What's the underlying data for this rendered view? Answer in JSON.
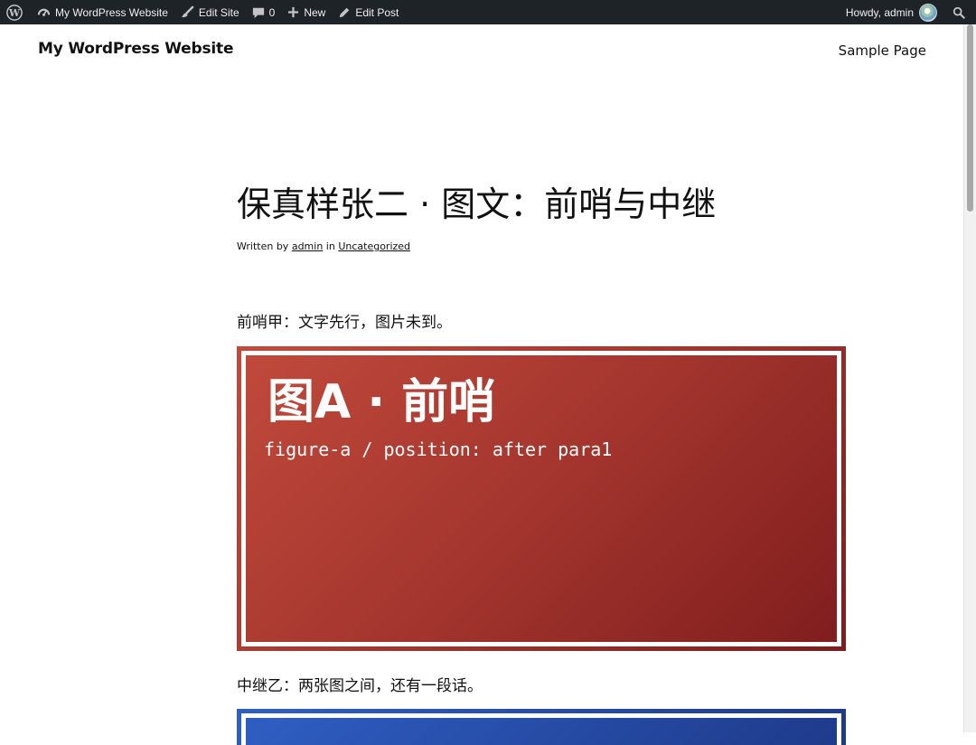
{
  "admin_bar": {
    "site_name": "My WordPress Website",
    "edit_site": "Edit Site",
    "comments_count": "0",
    "new_label": "New",
    "edit_post": "Edit Post",
    "howdy": "Howdy, admin",
    "icons": [
      "wordpress-logo-icon",
      "dashboard-icon",
      "brush-icon",
      "comment-bubble-icon",
      "plus-icon",
      "pencil-icon",
      "search-icon"
    ]
  },
  "header": {
    "site_title": "My WordPress Website",
    "nav": [
      "Sample Page"
    ]
  },
  "post": {
    "title": "保真样张二 · 图文：前哨与中继",
    "meta": {
      "written_by": "Written by",
      "author": "admin",
      "in": "in",
      "category": "Uncategorized"
    },
    "paragraphs": [
      "前哨甲：文字先行，图片未到。",
      "中继乙：两张图之间，还有一段话。"
    ],
    "figures": [
      {
        "title": "图A · 前哨",
        "caption": "figure-a / position: after para1",
        "colors": [
          "#c14a3c",
          "#7f1d1d"
        ]
      },
      {
        "colors": [
          "#2f5fc4",
          "#1e3a8a"
        ]
      }
    ]
  },
  "colors": {
    "admin_bar_bg": "#1d2327",
    "text": "#111111"
  }
}
